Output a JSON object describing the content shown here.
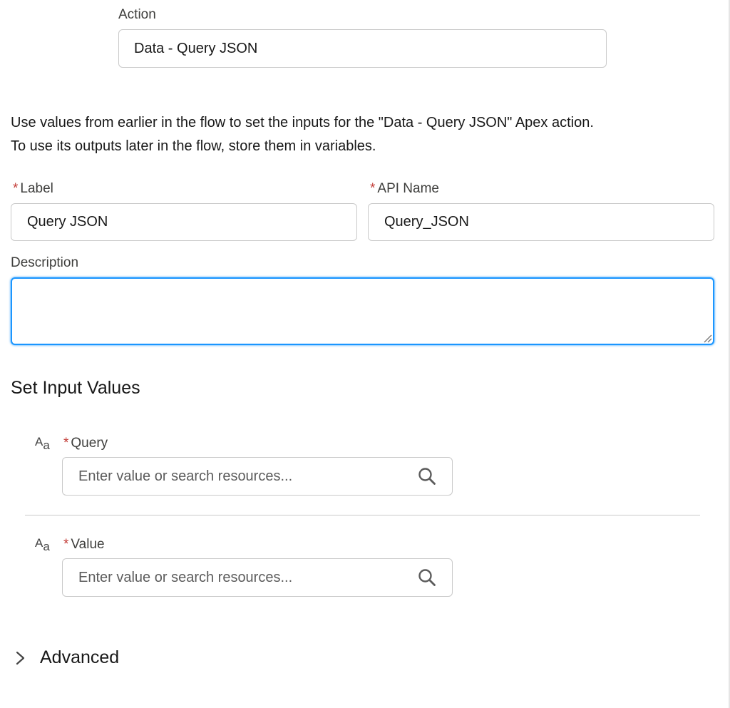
{
  "action": {
    "label": "Action",
    "value": "Data - Query JSON"
  },
  "help_text": {
    "line1": "Use values from earlier in the flow to set the inputs for the \"Data - Query JSON\" Apex action.",
    "line2": "To use its outputs later in the flow, store them in variables."
  },
  "label_field": {
    "label": "Label",
    "value": "Query JSON",
    "required_mark": "*"
  },
  "api_name_field": {
    "label": "API Name",
    "value": "Query_JSON",
    "required_mark": "*"
  },
  "description_field": {
    "label": "Description",
    "value": ""
  },
  "input_values": {
    "title": "Set Input Values",
    "items": [
      {
        "type_icon_main": "A",
        "type_icon_sub": "a",
        "required_mark": "*",
        "label": "Query",
        "placeholder": "Enter value or search resources..."
      },
      {
        "type_icon_main": "A",
        "type_icon_sub": "a",
        "required_mark": "*",
        "label": "Value",
        "placeholder": "Enter value or search resources..."
      }
    ]
  },
  "advanced": {
    "label": "Advanced",
    "icon": "chevron-right-icon"
  },
  "colors": {
    "required": "#c23934",
    "focus": "#1b96ff",
    "border": "#c9c9c9"
  }
}
